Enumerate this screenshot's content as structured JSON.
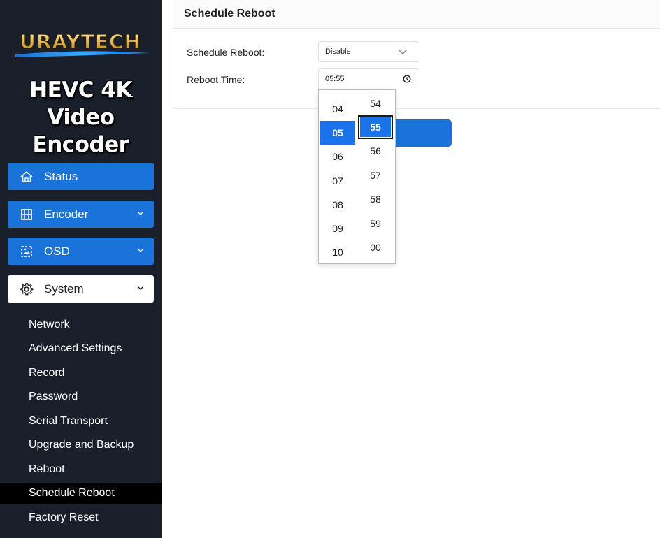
{
  "brand": {
    "logo_text": "URAYTECH",
    "product_line1": "HEVC 4K",
    "product_line2": "Video Encoder"
  },
  "sidebar": {
    "main_items": [
      {
        "label": "Status",
        "icon": "home-icon"
      },
      {
        "label": "Encoder",
        "icon": "film-icon"
      },
      {
        "label": "OSD",
        "icon": "image-icon"
      },
      {
        "label": "System",
        "icon": "gear-icon"
      }
    ],
    "sub_items": [
      {
        "label": "Network"
      },
      {
        "label": "Advanced Settings"
      },
      {
        "label": "Record"
      },
      {
        "label": "Password"
      },
      {
        "label": "Serial Transport"
      },
      {
        "label": "Upgrade and Backup"
      },
      {
        "label": "Reboot"
      },
      {
        "label": "Schedule Reboot"
      },
      {
        "label": "Factory Reset"
      }
    ],
    "selected_sub": "Schedule Reboot"
  },
  "panel": {
    "title": "Schedule Reboot",
    "schedule_label": "Schedule Reboot:",
    "schedule_value": "Disable",
    "time_label": "Reboot Time:",
    "time_value": "05:55"
  },
  "time_picker": {
    "hours": [
      "04",
      "05",
      "06",
      "07",
      "08",
      "09",
      "10"
    ],
    "minutes": [
      "54",
      "55",
      "56",
      "57",
      "58",
      "59",
      "00"
    ],
    "selected_hour": "05",
    "selected_minute": "55"
  },
  "colors": {
    "sidebar_bg": "#1a1f2c",
    "accent": "#1a73d9",
    "selected_bg": "#000000"
  }
}
